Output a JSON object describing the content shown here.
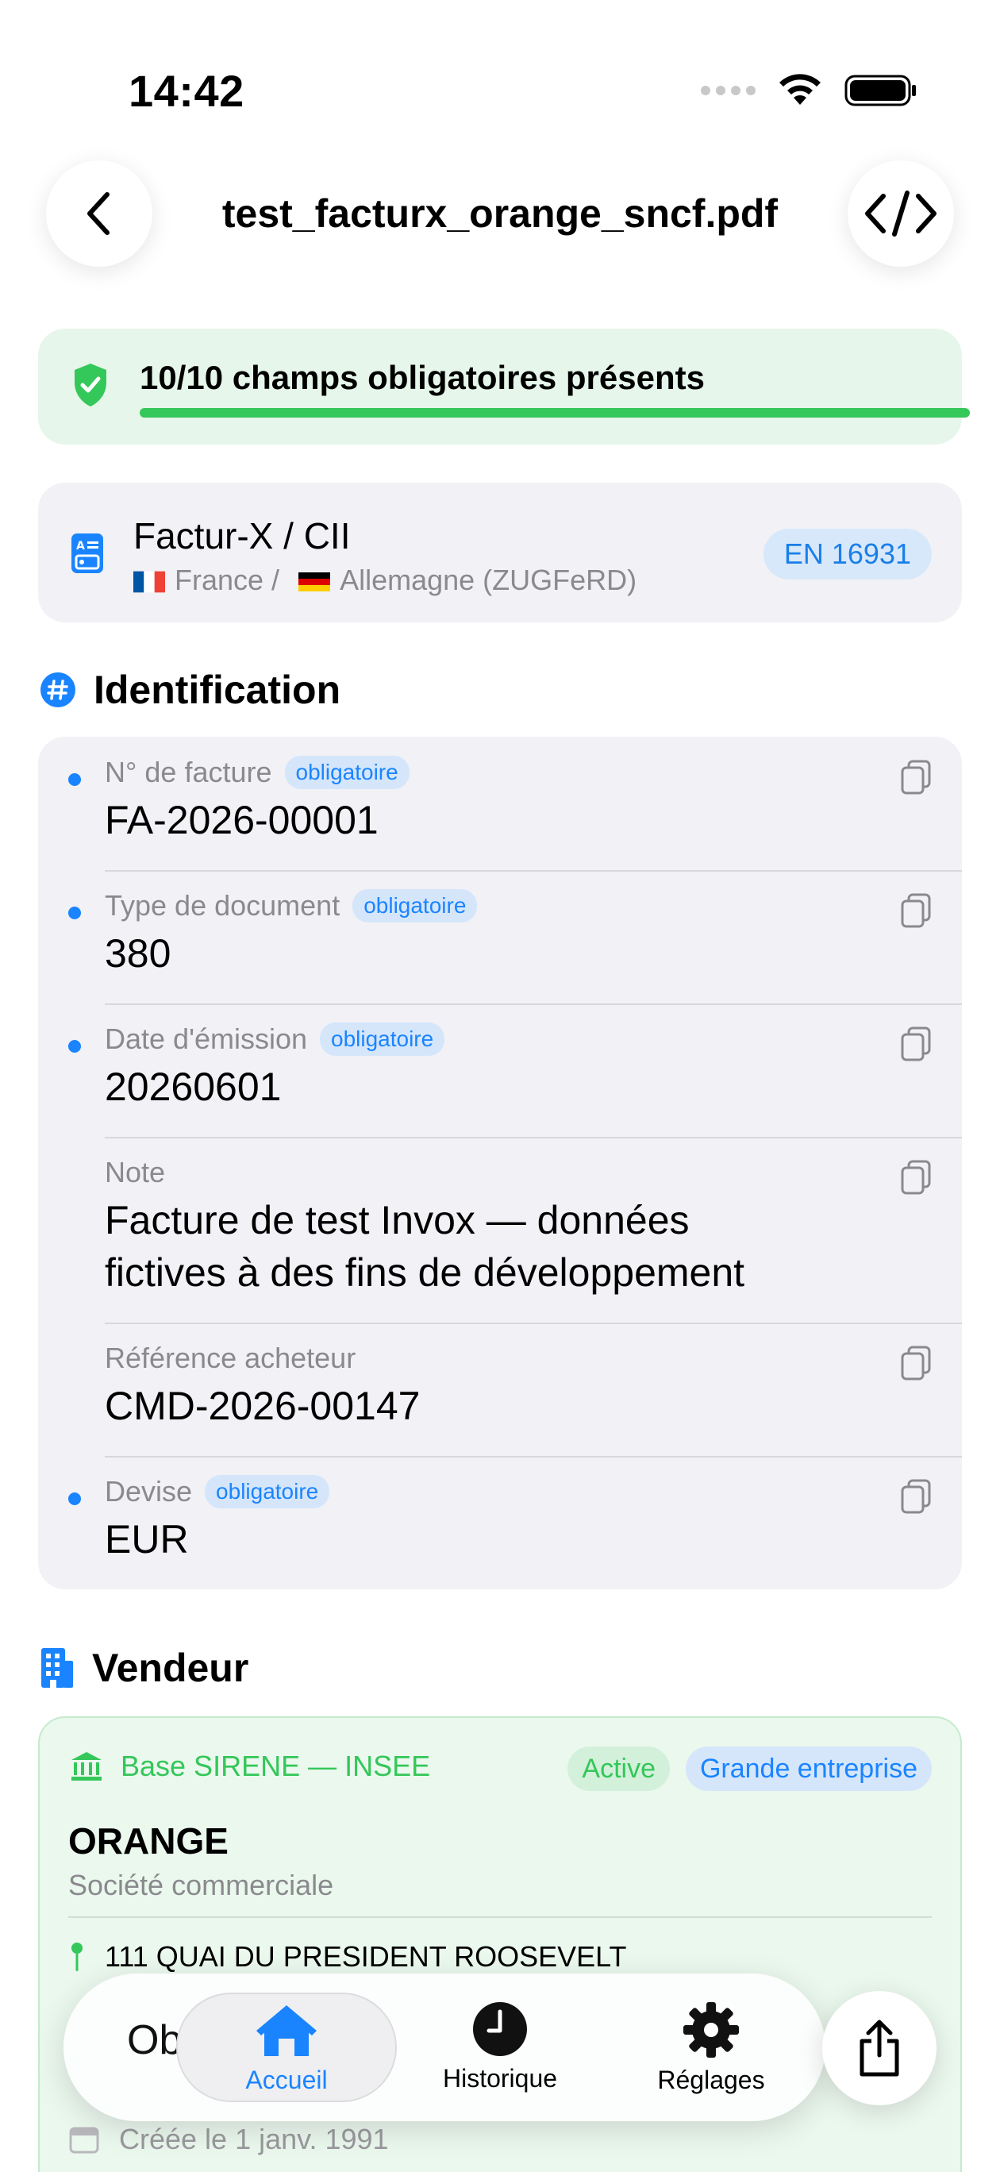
{
  "status_bar": {
    "time": "14:42"
  },
  "nav": {
    "title": "test_facturx_orange_sncf.pdf"
  },
  "validation": {
    "text": "10/10 champs obligatoires présents",
    "progress": 1.0
  },
  "format": {
    "title": "Factur-X / CII",
    "subtitle_a": "France /",
    "subtitle_b": "Allemagne (ZUGFeRD)",
    "badge": "EN 16931"
  },
  "identification": {
    "title": "Identification",
    "fields": [
      {
        "label": "N° de facture",
        "required": "obligatoire",
        "value": "FA-2026-00001"
      },
      {
        "label": "Type de document",
        "required": "obligatoire",
        "value": "380"
      },
      {
        "label": "Date d'émission",
        "required": "obligatoire",
        "value": "20260601"
      },
      {
        "label": "Note",
        "value_line1": "Facture de test Invox — données",
        "value_line2": "fictives à des fins de développement"
      },
      {
        "label": "Référence acheteur",
        "value": "CMD-2026-00147"
      },
      {
        "label": "Devise",
        "required": "obligatoire",
        "value": "EUR"
      }
    ]
  },
  "vendor": {
    "title": "Vendeur",
    "source": "Base SIRENE — INSEE",
    "status": "Active",
    "size": "Grande entreprise",
    "name": "ORANGE",
    "kind": "Société commerciale",
    "address": "111 QUAI DU PRESIDENT ROOSEVELT",
    "created": "Créée le 1 janv. 1991"
  },
  "tabbar": {
    "ghost_text": "Ob",
    "tabs": [
      {
        "label": "Accueil"
      },
      {
        "label": "Historique"
      },
      {
        "label": "Réglages"
      }
    ]
  },
  "colors": {
    "accent": "#1a84ff",
    "success": "#34c759"
  }
}
